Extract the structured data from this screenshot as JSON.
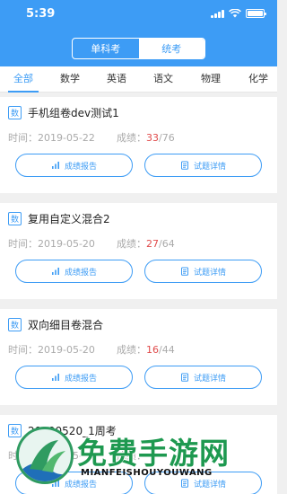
{
  "status_bar": {
    "time": "5:39"
  },
  "segment": {
    "items": [
      "单科考",
      "统考"
    ],
    "active_index": 1
  },
  "subject_tabs": [
    "全部",
    "数学",
    "英语",
    "语文",
    "物理",
    "化学"
  ],
  "subject_tabs_active_index": 0,
  "time_prefix": "时间：",
  "score_prefix": "成绩：",
  "buttons": {
    "report": "成绩报告",
    "detail": "试题详情"
  },
  "exams": [
    {
      "tag": "数",
      "title": "手机组卷dev测试1",
      "date": "2019-05-22",
      "score": "33",
      "total": "/76"
    },
    {
      "tag": "数",
      "title": "复用自定义混合2",
      "date": "2019-05-20",
      "score": "27",
      "total": "/64"
    },
    {
      "tag": "数",
      "title": "双向细目卷混合",
      "date": "2019-05-20",
      "score": "16",
      "total": "/44"
    },
    {
      "tag": "数",
      "title": "20190520_1周考",
      "date": "2019-05-",
      "score": "",
      "total": ""
    }
  ],
  "watermark": {
    "text": "免费手游网",
    "subtext": "MIANFEISHOUYOUWANG"
  },
  "colors": {
    "accent": "#3d9cf5",
    "score": "#e04b4b",
    "watermark": "#1e9950"
  }
}
